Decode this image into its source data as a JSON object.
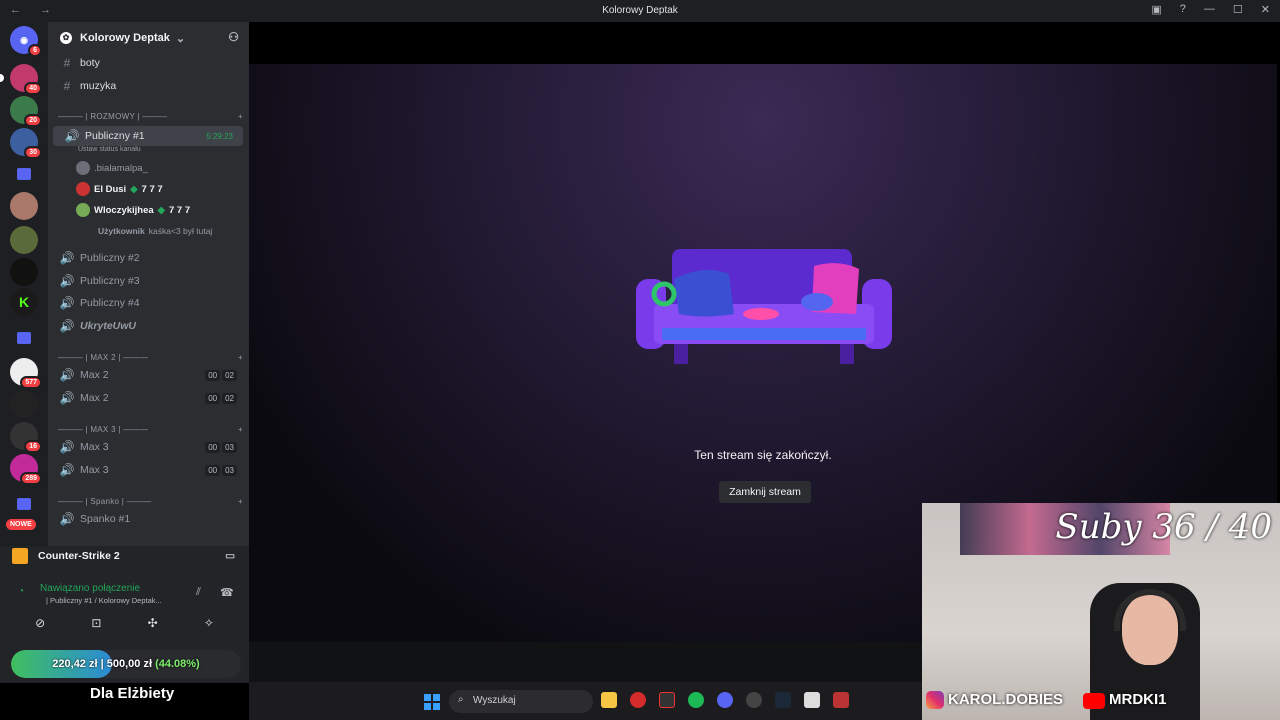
{
  "window": {
    "title": "Kolorowy Deptak",
    "nav": "← →",
    "controls": [
      "▣",
      "?",
      "—",
      "☐",
      "✕"
    ]
  },
  "servers": {
    "badges": [
      "6",
      "40",
      "20",
      "30",
      "577",
      "16",
      "289"
    ],
    "new_label": "NOWE"
  },
  "guild": {
    "name": "Kolorowy Deptak"
  },
  "channels": {
    "text": [
      {
        "name": "boty"
      },
      {
        "name": "muzyka"
      }
    ],
    "cat1": "——— | ROZMOWY | ———",
    "voice1": {
      "name": "Publiczny #1",
      "timer": "5:29:23",
      "status": "Ustaw status kanału"
    },
    "users": [
      {
        "name": ".bialamalpa_"
      },
      {
        "name": "El Dusi",
        "tag": "7 7 7"
      },
      {
        "name": "Wloczykijhea",
        "tag": "7 7 7"
      },
      {
        "name": "Użytkownik",
        "extra": "kaśka<3 był tutaj"
      }
    ],
    "voice_more": [
      "Publiczny #2",
      "Publiczny #3",
      "Publiczny #4"
    ],
    "hidden": "UkryteUwU",
    "cat2": "——— | MAX 2 | ———",
    "max2": [
      {
        "name": "Max 2",
        "a": "00",
        "b": "02"
      },
      {
        "name": "Max 2",
        "a": "00",
        "b": "02"
      }
    ],
    "cat3": "——— | MAX 3 | ———",
    "max3": [
      {
        "name": "Max 3",
        "a": "00",
        "b": "03"
      },
      {
        "name": "Max 3",
        "a": "00",
        "b": "03"
      }
    ],
    "cat4": "——— | Spanko | ———",
    "spanko": "Spanko #1"
  },
  "panel": {
    "game": "Counter-Strike 2",
    "connected": "Nawiązano połączenie",
    "connected_sub": "| Publiczny #1 / Kolorowy Deptak..."
  },
  "goal": {
    "current": "220,42 zł",
    "target": "500,00 zł",
    "percent": "(44.08%)",
    "fraction": 0.4408
  },
  "overlay": {
    "dla": "Dla Elżbiety",
    "suby": "Suby 36 / 40",
    "instagram": "KAROL.DOBIES",
    "youtube": "MRDKI1"
  },
  "stream": {
    "ended": "Ten stream się zakończył.",
    "close": "Zamknij stream"
  },
  "taskbar": {
    "search": "Wyszukaj"
  }
}
